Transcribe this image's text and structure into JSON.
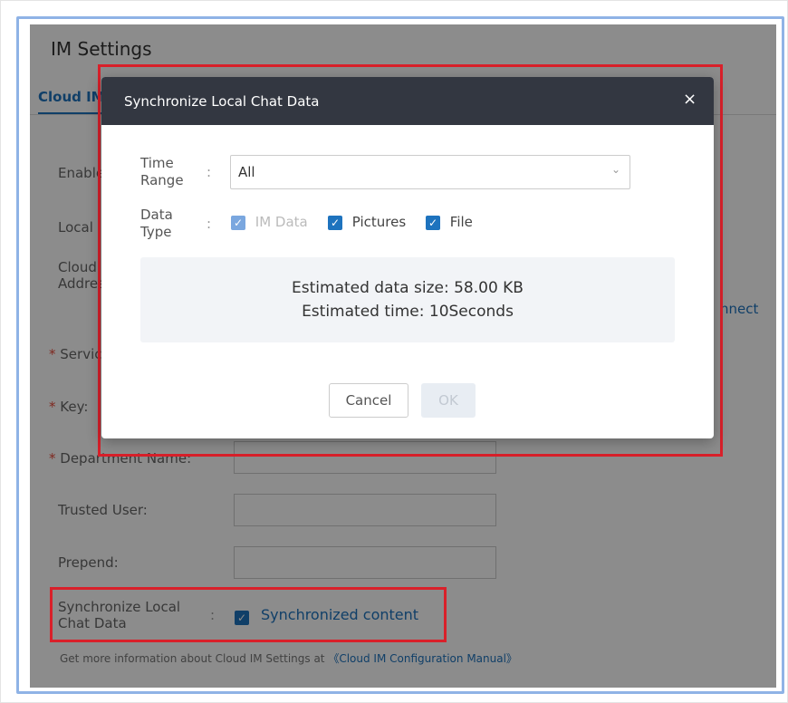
{
  "page": {
    "title": "IM Settings",
    "tab_label": "Cloud IM",
    "fields": {
      "enable_label": "Enable",
      "local_label": "Local",
      "cloud_line1": "Cloud",
      "cloud_line2": "Address",
      "service_label": "Service",
      "key_label": "Key:",
      "department_label": "Department Name:",
      "trusted_label": "Trusted User:",
      "prepend_label": "Prepend:",
      "connect_link": "nnect"
    },
    "sync": {
      "label_line1": "Synchronize Local",
      "label_line2": "Chat Data",
      "colon": ":",
      "checked": true,
      "text": "Synchronized content"
    },
    "info": {
      "prefix": "Get more information about Cloud IM Settings at",
      "link": "《Cloud IM Configuration Manual》"
    }
  },
  "modal": {
    "title": "Synchronize Local Chat Data",
    "close_glyph": "×",
    "time_range": {
      "label_line1": "Time",
      "label_line2": "Range",
      "colon": ":",
      "value": "All",
      "arrow": "⌄"
    },
    "data_type": {
      "label_line1": "Data",
      "label_line2": "Type",
      "colon": ":",
      "options": [
        {
          "label": "IM Data",
          "checked": true,
          "disabled": true
        },
        {
          "label": "Pictures",
          "checked": true,
          "disabled": false
        },
        {
          "label": "File",
          "checked": true,
          "disabled": false
        }
      ]
    },
    "estimate": {
      "size": "Estimated data size: 58.00 KB",
      "time": "Estimated time: 10Seconds"
    },
    "buttons": {
      "cancel": "Cancel",
      "ok": "OK"
    }
  },
  "colors": {
    "accent": "#1e73be",
    "highlight": "#d9202a",
    "modal_header": "#333741"
  }
}
